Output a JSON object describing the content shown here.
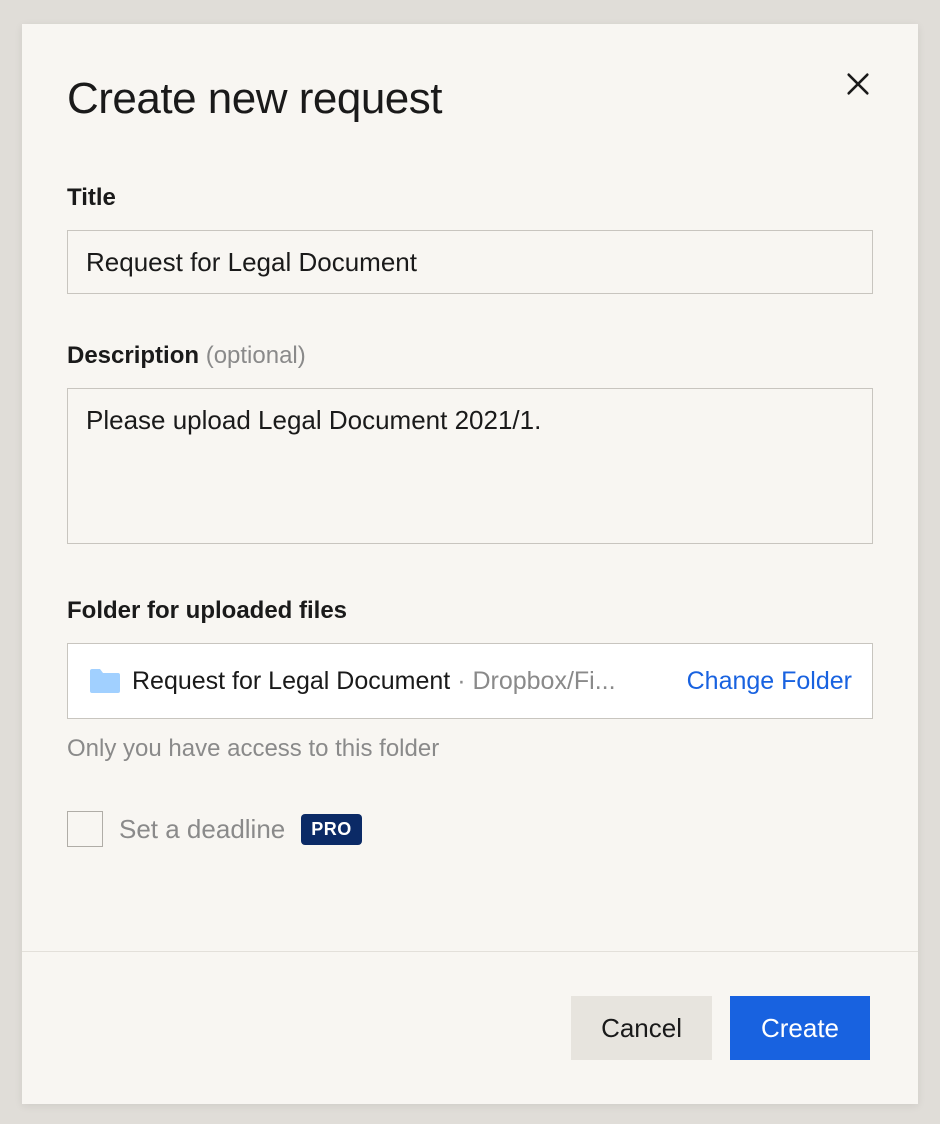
{
  "modal": {
    "title": "Create new request",
    "close_icon": "close"
  },
  "form": {
    "title_label": "Title",
    "title_value": "Request for Legal Document",
    "description_label": "Description",
    "description_optional": " (optional)",
    "description_value": "Please upload Legal Document 2021/1.",
    "folder_label": "Folder for uploaded files",
    "folder_name": "Request for Legal Document",
    "folder_separator": " · ",
    "folder_path": "Dropbox/Fi...",
    "change_folder": "Change Folder",
    "folder_note": "Only you have access to this folder",
    "deadline_label": "Set a deadline",
    "pro_badge": "PRO"
  },
  "footer": {
    "cancel": "Cancel",
    "create": "Create"
  },
  "colors": {
    "accent": "#1862e0",
    "folder_icon": "#a1d0ff",
    "pro_badge_bg": "#0b2a66"
  }
}
